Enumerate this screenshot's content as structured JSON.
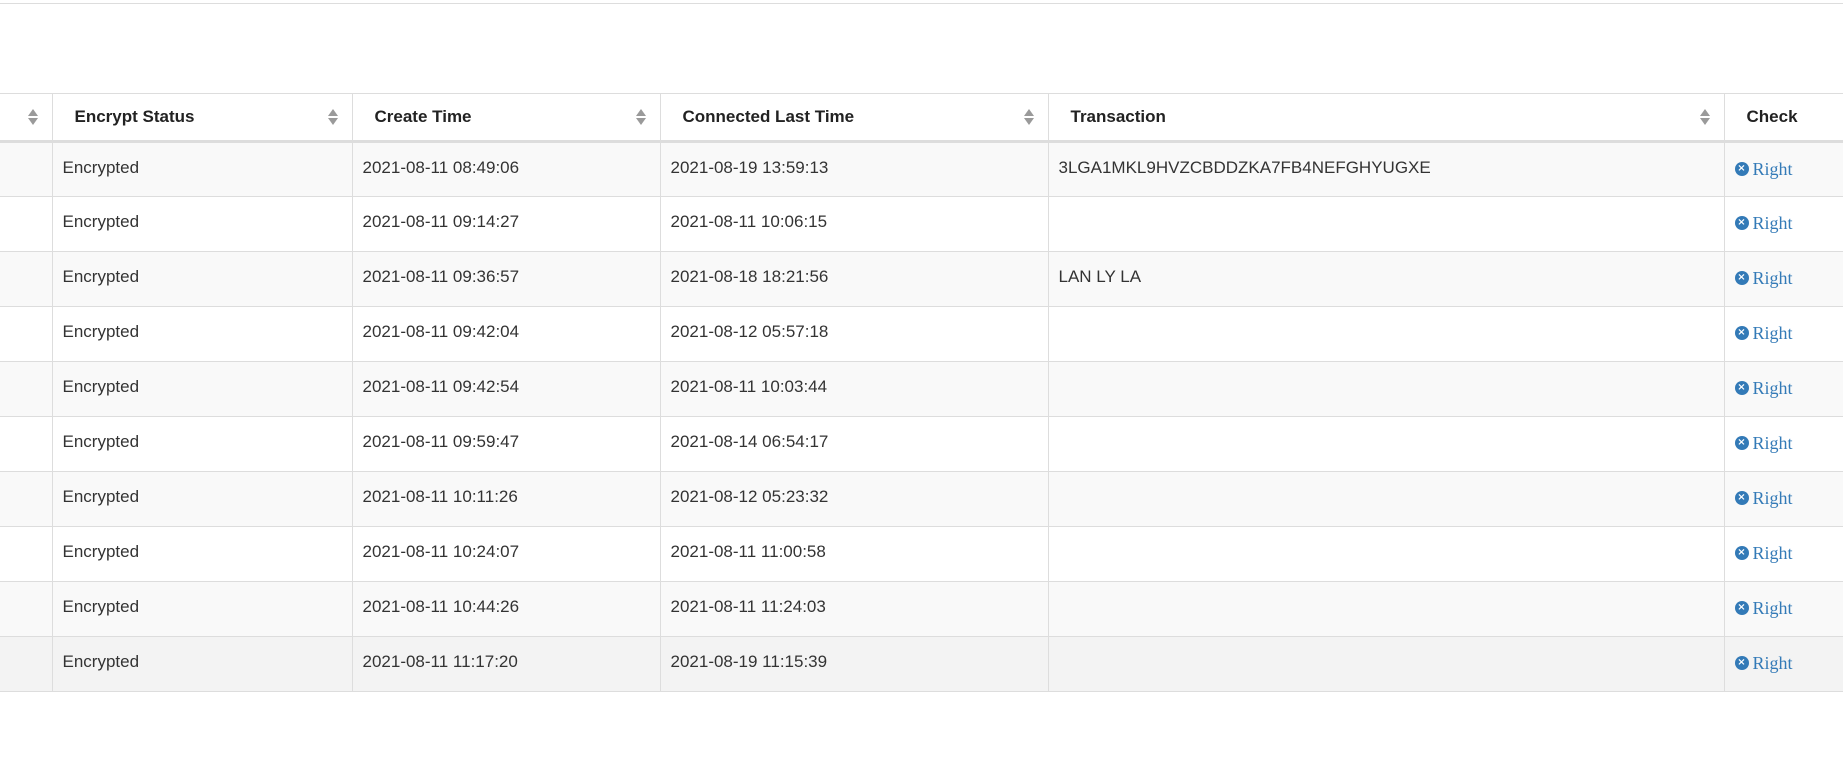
{
  "table": {
    "columns": [
      {
        "key": "first",
        "label": ""
      },
      {
        "key": "encrypt_status",
        "label": "Encrypt Status"
      },
      {
        "key": "create_time",
        "label": "Create Time"
      },
      {
        "key": "connected_last_time",
        "label": "Connected Last Time"
      },
      {
        "key": "transaction",
        "label": "Transaction"
      },
      {
        "key": "check",
        "label": "Check"
      }
    ],
    "rows": [
      {
        "encrypt_status": "Encrypted",
        "create_time": "2021-08-11 08:49:06",
        "connected_last_time": "2021-08-19 13:59:13",
        "transaction": "3LGA1MKL9HVZCBDDZKA7FB4NEFGHYUGXE",
        "check": "Right"
      },
      {
        "encrypt_status": "Encrypted",
        "create_time": "2021-08-11 09:14:27",
        "connected_last_time": "2021-08-11 10:06:15",
        "transaction": "",
        "check": "Right"
      },
      {
        "encrypt_status": "Encrypted",
        "create_time": "2021-08-11 09:36:57",
        "connected_last_time": "2021-08-18 18:21:56",
        "transaction": "LAN LY LA",
        "check": "Right"
      },
      {
        "encrypt_status": "Encrypted",
        "create_time": "2021-08-11 09:42:04",
        "connected_last_time": "2021-08-12 05:57:18",
        "transaction": "",
        "check": "Right"
      },
      {
        "encrypt_status": "Encrypted",
        "create_time": "2021-08-11 09:42:54",
        "connected_last_time": "2021-08-11 10:03:44",
        "transaction": "",
        "check": "Right"
      },
      {
        "encrypt_status": "Encrypted",
        "create_time": "2021-08-11 09:59:47",
        "connected_last_time": "2021-08-14 06:54:17",
        "transaction": "",
        "check": "Right"
      },
      {
        "encrypt_status": "Encrypted",
        "create_time": "2021-08-11 10:11:26",
        "connected_last_time": "2021-08-12 05:23:32",
        "transaction": "",
        "check": "Right"
      },
      {
        "encrypt_status": "Encrypted",
        "create_time": "2021-08-11 10:24:07",
        "connected_last_time": "2021-08-11 11:00:58",
        "transaction": "",
        "check": "Right"
      },
      {
        "encrypt_status": "Encrypted",
        "create_time": "2021-08-11 10:44:26",
        "connected_last_time": "2021-08-11 11:24:03",
        "transaction": "",
        "check": "Right"
      },
      {
        "encrypt_status": "Encrypted",
        "create_time": "2021-08-11 11:17:20",
        "connected_last_time": "2021-08-19 11:15:39",
        "transaction": "",
        "check": "Right"
      }
    ],
    "icons": {
      "sort": "sort-icon",
      "check": "times-circle-icon"
    },
    "colors": {
      "link": "#337ab7",
      "stripe": "#f9f9f9",
      "hover": "#f3f3f3",
      "border": "#dddddd"
    }
  }
}
